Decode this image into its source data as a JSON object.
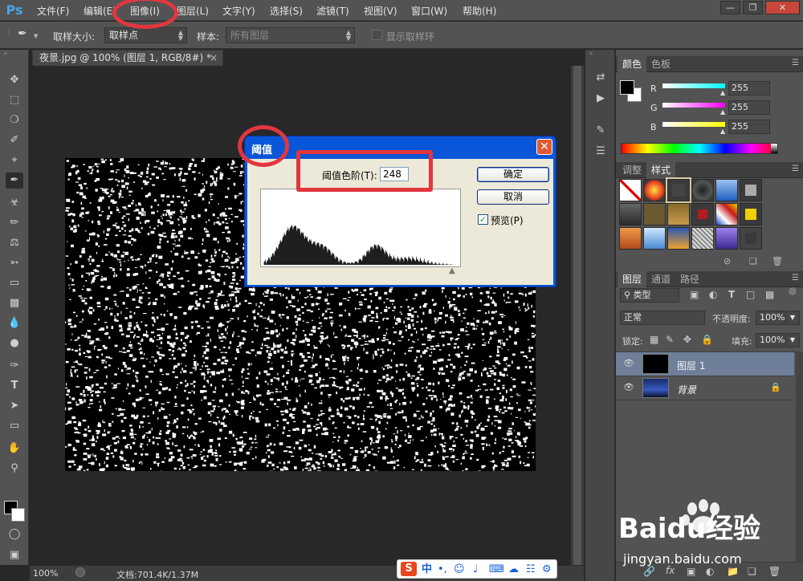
{
  "app": {
    "logo": "Ps"
  },
  "menubar": {
    "items": [
      "文件(F)",
      "编辑(E)",
      "图像(I)",
      "图层(L)",
      "文字(Y)",
      "选择(S)",
      "滤镜(T)",
      "视图(V)",
      "窗口(W)",
      "帮助(H)"
    ],
    "window_controls": [
      "minimize-icon",
      "restore-icon",
      "close-icon"
    ]
  },
  "options": {
    "tool_icon": "eyedropper-icon",
    "sample_size_label": "取样大小:",
    "sample_size_value": "取样点",
    "sample_label": "样本:",
    "sample_value": "所有图层",
    "show_ring_label": "显示取样环"
  },
  "document": {
    "tab_title": "夜景.jpg @ 100% (图层 1, RGB/8#) *",
    "zoom": "100%",
    "doc_info": "文档:701.4K/1.37M"
  },
  "dialog": {
    "title": "阈值",
    "threshold_label": "阈值色阶(T):",
    "threshold_value": "248",
    "ok_label": "确定",
    "cancel_label": "取消",
    "preview_label": "预览(P)",
    "preview_checked": true
  },
  "color_panel": {
    "tabs": [
      "颜色",
      "色板"
    ],
    "channels": [
      {
        "label": "R",
        "value": "255",
        "color": "#00ffff"
      },
      {
        "label": "G",
        "value": "255",
        "color": "#ff00ff"
      },
      {
        "label": "B",
        "value": "255",
        "color": "#ffff00"
      }
    ]
  },
  "styles_panel": {
    "tabs": [
      "调整",
      "样式"
    ]
  },
  "layers_panel": {
    "tabs": [
      "图层",
      "通道",
      "路径"
    ],
    "filter_label": "类型",
    "blend_mode": "正常",
    "opacity_label": "不透明度:",
    "opacity_value": "100%",
    "lock_label": "锁定:",
    "fill_label": "填充:",
    "fill_value": "100%",
    "layers": [
      {
        "name": "图层 1",
        "selected": true
      },
      {
        "name": "背景",
        "selected": false,
        "locked": true
      }
    ]
  },
  "ime": {
    "brand": "S",
    "mode": "中"
  },
  "watermark": {
    "brand": "Baidu经验",
    "url": "jingyan.baidu.com"
  }
}
